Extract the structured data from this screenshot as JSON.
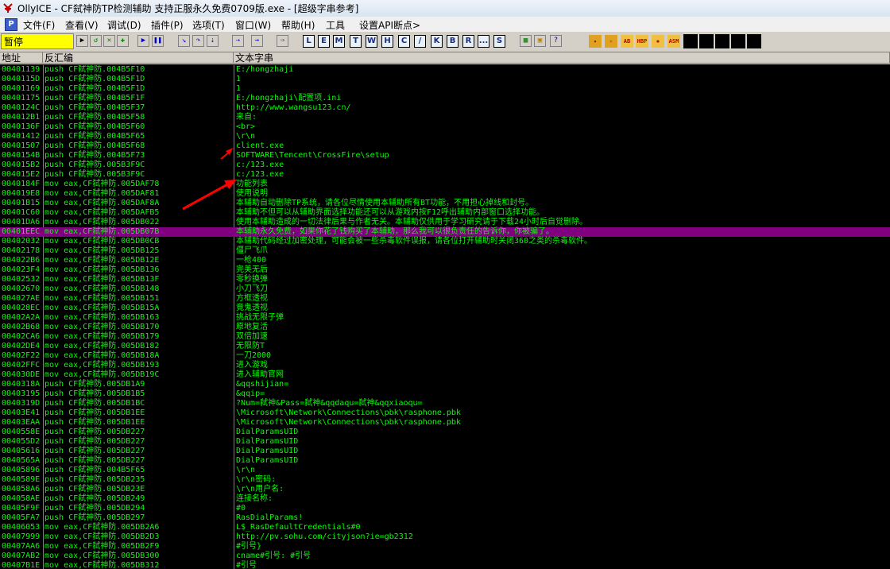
{
  "window": {
    "title": "OllyICE - CF弑神防TP检测辅助 支持正服永久免费0709版.exe - [超级字串参考]"
  },
  "menu": {
    "items": [
      "文件(F)",
      "查看(V)",
      "调试(D)",
      "插件(P)",
      "选项(T)",
      "窗口(W)",
      "帮助(H)",
      "工具",
      "设置API断点>"
    ]
  },
  "toolbar": {
    "status": "暂停",
    "letters": [
      "L",
      "E",
      "M",
      "T",
      "W",
      "H",
      "C",
      "/",
      "K",
      "B",
      "R",
      "...",
      "S"
    ],
    "icons": [
      "open-icon",
      "restart-icon",
      "close-icon",
      "run-icon",
      "pause-icon",
      "step-into-icon",
      "step-over-icon",
      "trace-into-icon",
      "trace-over-icon",
      "execute-till-return-icon",
      "goto-icon",
      "options-icon",
      "appearance-icon",
      "help-icon"
    ]
  },
  "columns": {
    "address": "地址",
    "disasm": "反汇编",
    "text": "文本字串"
  },
  "colors": {
    "text": "#00ff00",
    "background": "#000000",
    "selection": "#800080",
    "status": "#ffff00",
    "arrow": "#ff0000"
  },
  "rows": [
    {
      "addr": "00401139",
      "dis": "push CF弑神防.004B5F10",
      "txt": "E:/hongzhaji"
    },
    {
      "addr": "0040115D",
      "dis": "push CF弑神防.004B5F1D",
      "txt": "1"
    },
    {
      "addr": "00401169",
      "dis": "push CF弑神防.004B5F1D",
      "txt": "1"
    },
    {
      "addr": "00401175",
      "dis": "push CF弑神防.004B5F1F",
      "txt": "E:/hongzhaji\\配置项.ini"
    },
    {
      "addr": "0040124C",
      "dis": "push CF弑神防.004B5F37",
      "txt": "http://www.wangsu123.cn/"
    },
    {
      "addr": "004012B1",
      "dis": "push CF弑神防.004B5F58",
      "txt": "来自:"
    },
    {
      "addr": "0040136F",
      "dis": "push CF弑神防.004B5F60",
      "txt": "<br>"
    },
    {
      "addr": "00401412",
      "dis": "push CF弑神防.004B5F65",
      "txt": "\\r\\n"
    },
    {
      "addr": "00401507",
      "dis": "push CF弑神防.004B5F68",
      "txt": "client.exe"
    },
    {
      "addr": "0040154B",
      "dis": "push CF弑神防.004B5F73",
      "txt": "SOFTWARE\\Tencent\\CrossFire\\setup"
    },
    {
      "addr": "004015B2",
      "dis": "push CF弑神防.005B3F9C",
      "txt": "c:/123.exe"
    },
    {
      "addr": "004015E2",
      "dis": "push CF弑神防.005B3F9C",
      "txt": "c:/123.exe"
    },
    {
      "addr": "0040184F",
      "dis": "mov eax,CF弑神防.005DAF78",
      "txt": "功能列表"
    },
    {
      "addr": "004019E8",
      "dis": "mov eax,CF弑神防.005DAF81",
      "txt": "使用说明"
    },
    {
      "addr": "00401B15",
      "dis": "mov eax,CF弑神防.005DAF8A",
      "txt": "本辅助自动删除TP系统，请各位尽情使用本辅助所有BT功能，不用担心掉线和封号。"
    },
    {
      "addr": "00401C60",
      "dis": "mov eax,CF弑神防.005DAFB5",
      "txt": "本辅助不但可以从辅助界面选择功能还可以从游戏内按F12呼出辅助内部窗口选择功能。"
    },
    {
      "addr": "00401DA6",
      "dis": "mov eax,CF弑神防.005DB022",
      "txt": "使用本辅助造成的一切法律后果与作者无关。本辅助仅供用于学习研究请于下载24小时后自觉删除。"
    },
    {
      "addr": "00401EEC",
      "dis": "mov eax,CF弑神防.005DB07B",
      "txt": "本辅助永久免费，如果你花了钱购买了本辅助，那么我可以很负责任的告诉你，你被骗了。",
      "sel": true
    },
    {
      "addr": "00402032",
      "dis": "mov eax,CF弑神防.005DB0CB",
      "txt": "本辅助代码经过加密处理，可能会被一些杀毒软件误报，请各位打开辅助时关闭360之类的杀毒软件。"
    },
    {
      "addr": "00402178",
      "dis": "mov eax,CF弑神防.005DB125",
      "txt": "僵尸飞爪"
    },
    {
      "addr": "004022B6",
      "dis": "mov eax,CF弑神防.005DB12E",
      "txt": "一枪400"
    },
    {
      "addr": "004023F4",
      "dis": "mov eax,CF弑神防.005DB136",
      "txt": "完美无后"
    },
    {
      "addr": "00402532",
      "dis": "mov eax,CF弑神防.005DB13F",
      "txt": "零秒换弹"
    },
    {
      "addr": "00402670",
      "dis": "mov eax,CF弑神防.005DB148",
      "txt": "小刀飞刀"
    },
    {
      "addr": "004027AE",
      "dis": "mov eax,CF弑神防.005DB151",
      "txt": "方框透视"
    },
    {
      "addr": "004028EC",
      "dis": "mov eax,CF弑神防.005DB15A",
      "txt": "竟鬼透视"
    },
    {
      "addr": "00402A2A",
      "dis": "mov eax,CF弑神防.005DB163",
      "txt": "挑战无限子弹"
    },
    {
      "addr": "00402B68",
      "dis": "mov eax,CF弑神防.005DB170",
      "txt": "原地复活"
    },
    {
      "addr": "00402CA6",
      "dis": "mov eax,CF弑神防.005DB179",
      "txt": "双倍加速"
    },
    {
      "addr": "00402DE4",
      "dis": "mov eax,CF弑神防.005DB182",
      "txt": "无限防T"
    },
    {
      "addr": "00402F22",
      "dis": "mov eax,CF弑神防.005DB18A",
      "txt": "一刀2000"
    },
    {
      "addr": "00402FFC",
      "dis": "mov eax,CF弑神防.005DB193",
      "txt": "进入游戏"
    },
    {
      "addr": "004030DE",
      "dis": "mov eax,CF弑神防.005DB19C",
      "txt": "进入辅助官网"
    },
    {
      "addr": "0040318A",
      "dis": "push CF弑神防.005DB1A9",
      "txt": "&qqshijian="
    },
    {
      "addr": "00403195",
      "dis": "push CF弑神防.005DB1B5",
      "txt": "&qqip="
    },
    {
      "addr": "0040319D",
      "dis": "push CF弑神防.005DB1BC",
      "txt": "?Num=弑神&Pass=弑神&qqdaqu=弑神&qqxiaoqu="
    },
    {
      "addr": "00403E41",
      "dis": "push CF弑神防.005DB1EE",
      "txt": "\\Microsoft\\Network\\Connections\\pbk\\rasphone.pbk"
    },
    {
      "addr": "00403EAA",
      "dis": "push CF弑神防.005DB1EE",
      "txt": "\\Microsoft\\Network\\Connections\\pbk\\rasphone.pbk"
    },
    {
      "addr": "0040558E",
      "dis": "push CF弑神防.005DB227",
      "txt": "DialParamsUID"
    },
    {
      "addr": "004055D2",
      "dis": "push CF弑神防.005DB227",
      "txt": "DialParamsUID"
    },
    {
      "addr": "00405616",
      "dis": "push CF弑神防.005DB227",
      "txt": "DialParamsUID"
    },
    {
      "addr": "0040565A",
      "dis": "push CF弑神防.005DB227",
      "txt": "DialParamsUID"
    },
    {
      "addr": "00405896",
      "dis": "push CF弑神防.004B5F65",
      "txt": "\\r\\n"
    },
    {
      "addr": "0040589E",
      "dis": "push CF弑神防.005DB235",
      "txt": "\\r\\n密码:"
    },
    {
      "addr": "004058A6",
      "dis": "push CF弑神防.005DB23E",
      "txt": "\\r\\n用户名:"
    },
    {
      "addr": "004058AE",
      "dis": "push CF弑神防.005DB249",
      "txt": "连接名称:"
    },
    {
      "addr": "00405F9F",
      "dis": "push CF弑神防.005DB294",
      "txt": "#0"
    },
    {
      "addr": "00405FA7",
      "dis": "push CF弑神防.005DB297",
      "txt": "RasDialParams!"
    },
    {
      "addr": "00406053",
      "dis": "mov eax,CF弑神防.005DB2A6",
      "txt": "L$_RasDefaultCredentials#0"
    },
    {
      "addr": "00407999",
      "dis": "mov eax,CF弑神防.005DB2D3",
      "txt": "http://pv.sohu.com/cityjson?ie=gb2312"
    },
    {
      "addr": "00407AA6",
      "dis": "mov eax,CF弑神防.005DB2F9",
      "txt": "#引号}"
    },
    {
      "addr": "00407AB2",
      "dis": "mov eax,CF弑神防.005DB300",
      "txt": "cname#引号: #引号"
    },
    {
      "addr": "00407B1E",
      "dis": "mov eax,CF弑神防.005DB312",
      "txt": "#引号"
    }
  ]
}
